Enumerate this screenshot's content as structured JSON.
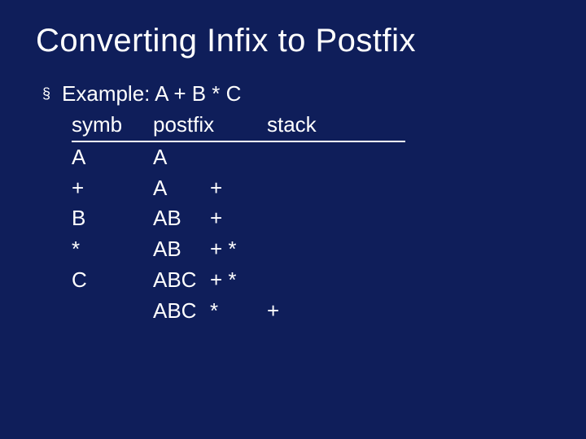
{
  "title": "Converting Infix to Postfix",
  "bullet": {
    "glyph": "§",
    "text": "Example: A + B * C"
  },
  "headers": {
    "symb": "symb",
    "postfix": "postfix",
    "stack": "stack"
  },
  "rows": [
    {
      "symb": "A",
      "postfix": "A",
      "extra": "",
      "stack": ""
    },
    {
      "symb": "+",
      "postfix": "A",
      "extra": "+",
      "stack": ""
    },
    {
      "symb": "B",
      "postfix": "AB",
      "extra": "+",
      "stack": ""
    },
    {
      "symb": "*",
      "postfix": "AB",
      "extra": "+ *",
      "stack": ""
    },
    {
      "symb": "C",
      "postfix": "ABC",
      "extra": "+ *",
      "stack": ""
    },
    {
      "symb": "",
      "postfix": "ABC",
      "extra": "*",
      "stack": "+"
    }
  ]
}
